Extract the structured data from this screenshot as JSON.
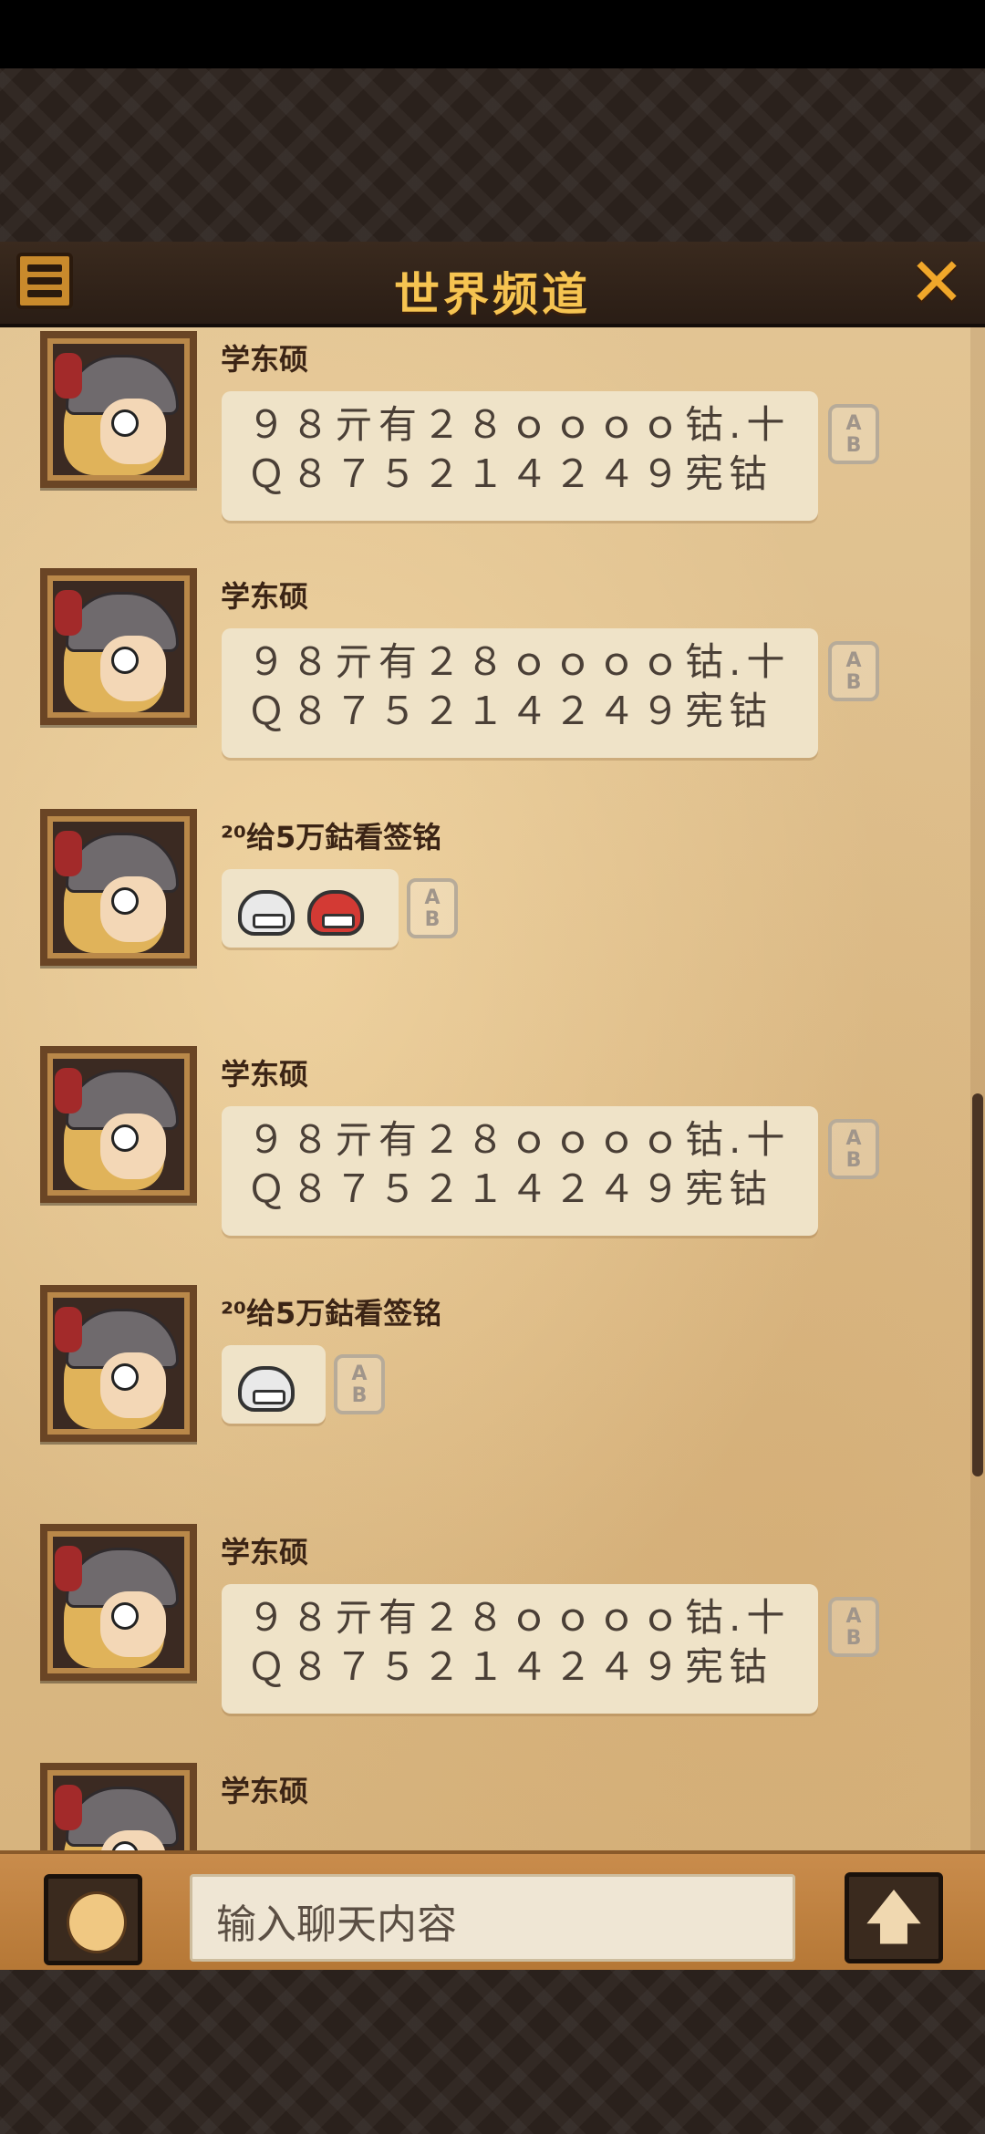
{
  "header": {
    "title": "世界频道"
  },
  "icons": {
    "menu": "list-menu-icon",
    "close": "close-x-icon",
    "translate": "translate-ab-icon",
    "emoji_button": "smiley-face-icon",
    "send": "up-arrow-icon"
  },
  "translate_label_a": "A",
  "translate_label_b": "B",
  "messages": [
    {
      "name": "学东硕",
      "text": "９８亓有２８ｏｏｏｏ钴.十Ｑ８７５２１４２４９宪钴"
    },
    {
      "name": "学东硕",
      "text": "９８亓有２８ｏｏｏｏ钴.十Ｑ８７５２１４２４９宪钴"
    },
    {
      "name": "²⁰给5万鈷看签铭",
      "emojis": [
        "grin-face-emoji",
        "angry-face-emoji"
      ]
    },
    {
      "name": "学东硕",
      "text": "９８亓有２８ｏｏｏｏ钴.十Ｑ８７５２１４２４９宪钴"
    },
    {
      "name": "²⁰给5万鈷看签铭",
      "emojis": [
        "grin-face-emoji"
      ]
    },
    {
      "name": "学东硕",
      "text": "９８亓有２８ｏｏｏｏ钴.十Ｑ８７５２１４２４９宪钴"
    },
    {
      "name": "学东硕"
    }
  ],
  "footer": {
    "input_placeholder": "输入聊天内容",
    "send_label": "🡅"
  },
  "colors": {
    "title": "#f6c451",
    "parchment": "#e2c493",
    "bubble": "#efe3c8"
  }
}
